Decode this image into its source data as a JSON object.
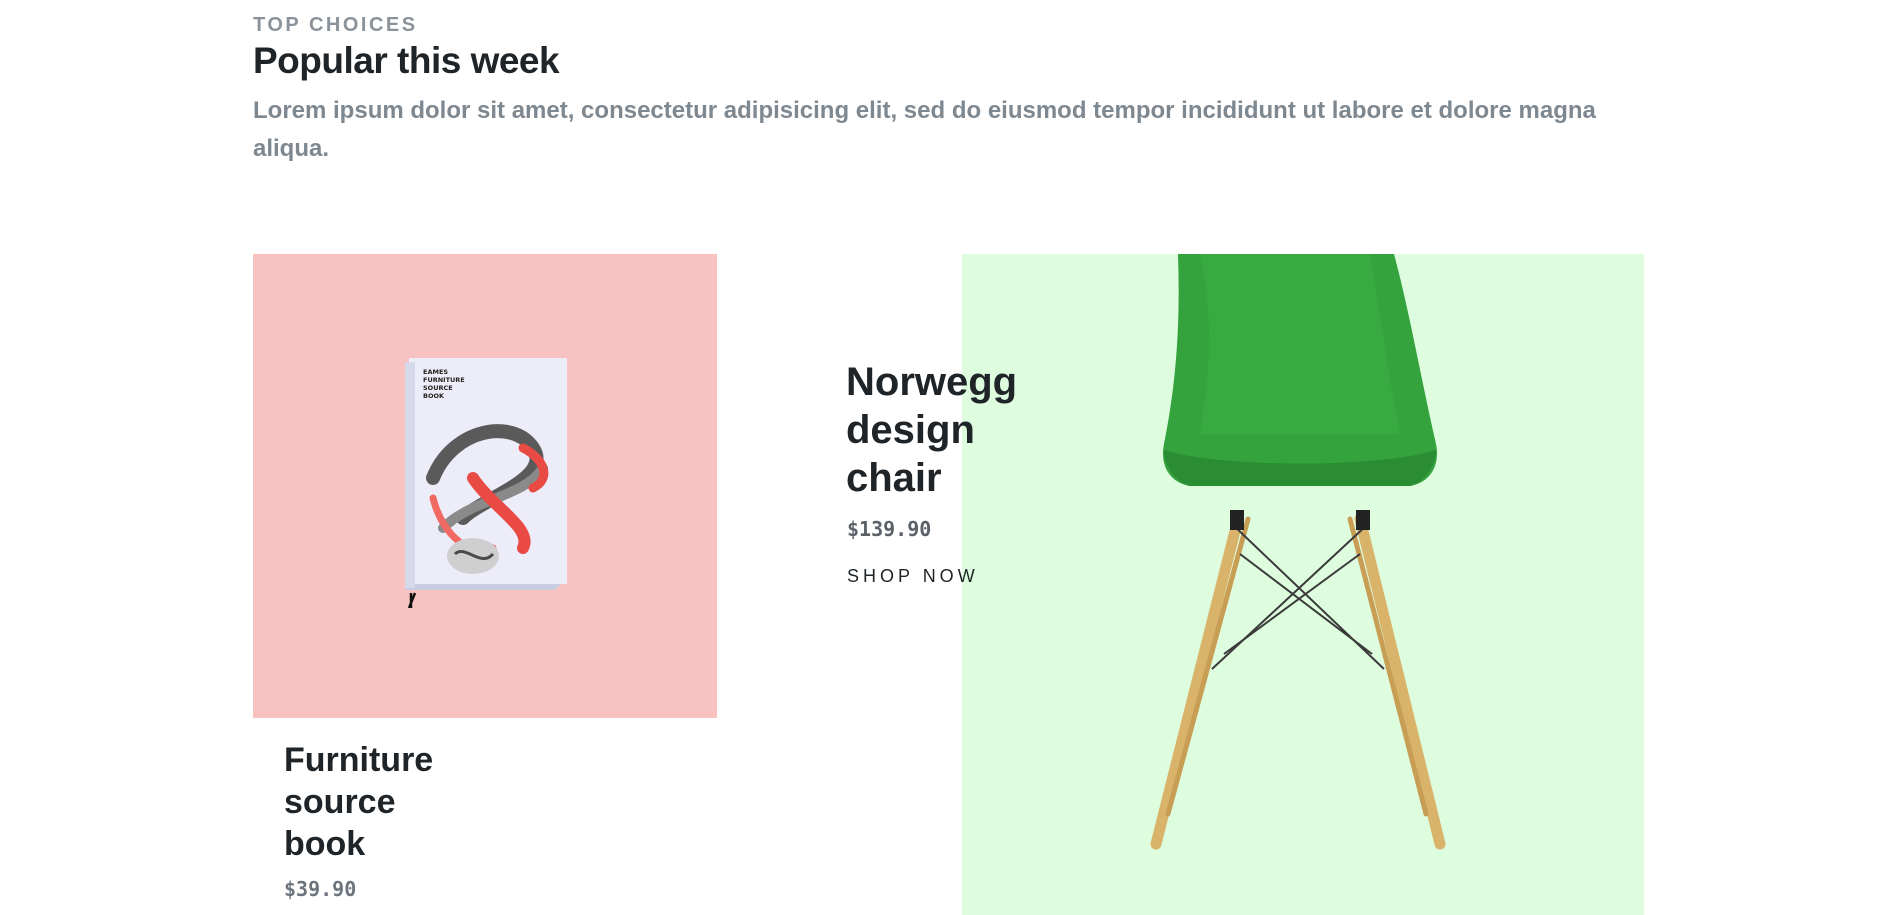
{
  "section": {
    "eyebrow": "TOP CHOICES",
    "title": "Popular this week",
    "description": "Lorem ipsum dolor sit amet, consectetur adipisicing elit, sed do eiusmod tempor incididunt ut labore et dolore magna aliqua."
  },
  "products": [
    {
      "name": "Furniture source book",
      "price": "$39.90",
      "bg_color": "#f7c2c0",
      "image_text": [
        "EAMES",
        "FURNITURE",
        "SOURCE",
        "BOOK"
      ]
    },
    {
      "name": "Norwegg design chair",
      "price": "$139.90",
      "cta": "SHOP NOW",
      "bg_color": "#defddf"
    }
  ],
  "colors": {
    "heading": "#1f2428",
    "muted": "#8a929b",
    "chair_green": "#34a33d"
  }
}
